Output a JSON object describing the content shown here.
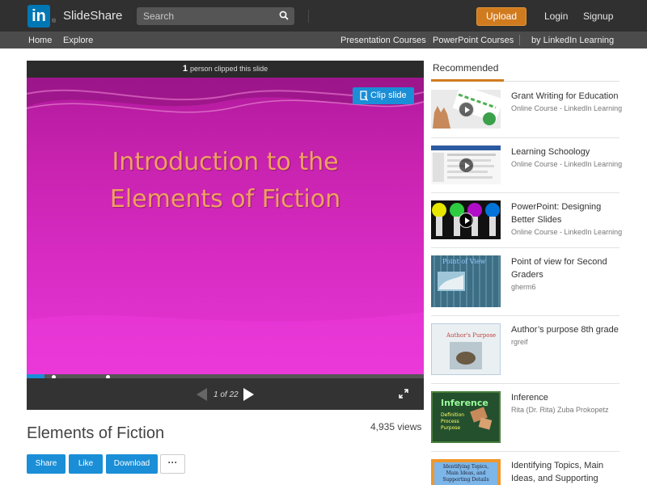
{
  "header": {
    "logo_in": "in",
    "logo_reg": "®",
    "logo_text": "SlideShare",
    "search_placeholder": "Search",
    "upload_label": "Upload",
    "login_label": "Login",
    "signup_label": "Signup"
  },
  "nav": {
    "home": "Home",
    "explore": "Explore",
    "presentation_courses": "Presentation Courses",
    "powerpoint_courses": "PowerPoint Courses",
    "linkedin_learning": "by LinkedIn Learning"
  },
  "player": {
    "clip_count": "1",
    "clip_text": "person clipped this slide",
    "clip_button": "Clip slide",
    "slide_title_line1": "Introduction to the",
    "slide_title_line2": "Elements of Fiction",
    "page_indicator": "1 of 22",
    "progress_fraction": 0.045
  },
  "deck": {
    "title": "Elements of Fiction",
    "views": "4,935 views",
    "share": "Share",
    "like": "Like",
    "download": "Download",
    "more": "···"
  },
  "recommended": {
    "tab_label": "Recommended",
    "items": [
      {
        "title": "Grant Writing for Education",
        "subtitle": "Online Course - LinkedIn Learning"
      },
      {
        "title": "Learning Schoology",
        "subtitle": "Online Course - LinkedIn Learning"
      },
      {
        "title": "PowerPoint: Designing Better Slides",
        "subtitle": "Online Course - LinkedIn Learning"
      },
      {
        "title": "Point of view for Second Graders",
        "subtitle": "gherm6"
      },
      {
        "title": "Author’s purpose 8th grade",
        "subtitle": "rgreif"
      },
      {
        "title": "Inference",
        "subtitle": "Rita (Dr. Rita) Zuba Prokopetz"
      },
      {
        "title": "Identifying Topics, Main Ideas, and Supporting",
        "subtitle": ""
      }
    ],
    "thumb_texts": {
      "pov": "Point of View",
      "author": "Author's Purpose",
      "inference_heading": "Inference",
      "inference_lines": [
        "Definition",
        "Process",
        "Purpose"
      ],
      "topics": "Identifying Topics, Main Ideas, and Supporting Details"
    }
  },
  "colors": {
    "accent_orange": "#d17b1f",
    "accent_blue": "#1a8ed6",
    "linkedin_blue": "#0077b5"
  }
}
